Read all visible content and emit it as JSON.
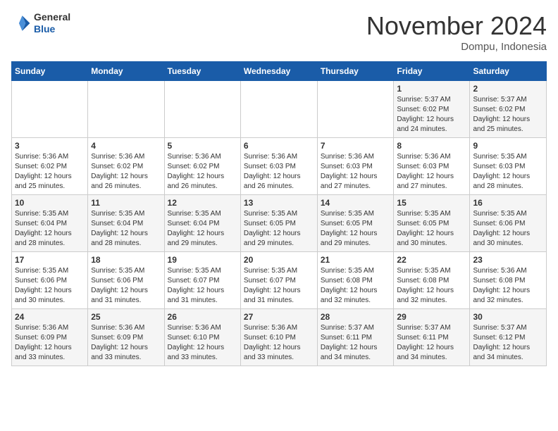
{
  "header": {
    "logo_line1": "General",
    "logo_line2": "Blue",
    "month_title": "November 2024",
    "location": "Dompu, Indonesia"
  },
  "weekdays": [
    "Sunday",
    "Monday",
    "Tuesday",
    "Wednesday",
    "Thursday",
    "Friday",
    "Saturday"
  ],
  "weeks": [
    [
      {
        "day": "",
        "info": ""
      },
      {
        "day": "",
        "info": ""
      },
      {
        "day": "",
        "info": ""
      },
      {
        "day": "",
        "info": ""
      },
      {
        "day": "",
        "info": ""
      },
      {
        "day": "1",
        "info": "Sunrise: 5:37 AM\nSunset: 6:02 PM\nDaylight: 12 hours and 24 minutes."
      },
      {
        "day": "2",
        "info": "Sunrise: 5:37 AM\nSunset: 6:02 PM\nDaylight: 12 hours and 25 minutes."
      }
    ],
    [
      {
        "day": "3",
        "info": "Sunrise: 5:36 AM\nSunset: 6:02 PM\nDaylight: 12 hours and 25 minutes."
      },
      {
        "day": "4",
        "info": "Sunrise: 5:36 AM\nSunset: 6:02 PM\nDaylight: 12 hours and 26 minutes."
      },
      {
        "day": "5",
        "info": "Sunrise: 5:36 AM\nSunset: 6:02 PM\nDaylight: 12 hours and 26 minutes."
      },
      {
        "day": "6",
        "info": "Sunrise: 5:36 AM\nSunset: 6:03 PM\nDaylight: 12 hours and 26 minutes."
      },
      {
        "day": "7",
        "info": "Sunrise: 5:36 AM\nSunset: 6:03 PM\nDaylight: 12 hours and 27 minutes."
      },
      {
        "day": "8",
        "info": "Sunrise: 5:36 AM\nSunset: 6:03 PM\nDaylight: 12 hours and 27 minutes."
      },
      {
        "day": "9",
        "info": "Sunrise: 5:35 AM\nSunset: 6:03 PM\nDaylight: 12 hours and 28 minutes."
      }
    ],
    [
      {
        "day": "10",
        "info": "Sunrise: 5:35 AM\nSunset: 6:04 PM\nDaylight: 12 hours and 28 minutes."
      },
      {
        "day": "11",
        "info": "Sunrise: 5:35 AM\nSunset: 6:04 PM\nDaylight: 12 hours and 28 minutes."
      },
      {
        "day": "12",
        "info": "Sunrise: 5:35 AM\nSunset: 6:04 PM\nDaylight: 12 hours and 29 minutes."
      },
      {
        "day": "13",
        "info": "Sunrise: 5:35 AM\nSunset: 6:05 PM\nDaylight: 12 hours and 29 minutes."
      },
      {
        "day": "14",
        "info": "Sunrise: 5:35 AM\nSunset: 6:05 PM\nDaylight: 12 hours and 29 minutes."
      },
      {
        "day": "15",
        "info": "Sunrise: 5:35 AM\nSunset: 6:05 PM\nDaylight: 12 hours and 30 minutes."
      },
      {
        "day": "16",
        "info": "Sunrise: 5:35 AM\nSunset: 6:06 PM\nDaylight: 12 hours and 30 minutes."
      }
    ],
    [
      {
        "day": "17",
        "info": "Sunrise: 5:35 AM\nSunset: 6:06 PM\nDaylight: 12 hours and 30 minutes."
      },
      {
        "day": "18",
        "info": "Sunrise: 5:35 AM\nSunset: 6:06 PM\nDaylight: 12 hours and 31 minutes."
      },
      {
        "day": "19",
        "info": "Sunrise: 5:35 AM\nSunset: 6:07 PM\nDaylight: 12 hours and 31 minutes."
      },
      {
        "day": "20",
        "info": "Sunrise: 5:35 AM\nSunset: 6:07 PM\nDaylight: 12 hours and 31 minutes."
      },
      {
        "day": "21",
        "info": "Sunrise: 5:35 AM\nSunset: 6:08 PM\nDaylight: 12 hours and 32 minutes."
      },
      {
        "day": "22",
        "info": "Sunrise: 5:35 AM\nSunset: 6:08 PM\nDaylight: 12 hours and 32 minutes."
      },
      {
        "day": "23",
        "info": "Sunrise: 5:36 AM\nSunset: 6:08 PM\nDaylight: 12 hours and 32 minutes."
      }
    ],
    [
      {
        "day": "24",
        "info": "Sunrise: 5:36 AM\nSunset: 6:09 PM\nDaylight: 12 hours and 33 minutes."
      },
      {
        "day": "25",
        "info": "Sunrise: 5:36 AM\nSunset: 6:09 PM\nDaylight: 12 hours and 33 minutes."
      },
      {
        "day": "26",
        "info": "Sunrise: 5:36 AM\nSunset: 6:10 PM\nDaylight: 12 hours and 33 minutes."
      },
      {
        "day": "27",
        "info": "Sunrise: 5:36 AM\nSunset: 6:10 PM\nDaylight: 12 hours and 33 minutes."
      },
      {
        "day": "28",
        "info": "Sunrise: 5:37 AM\nSunset: 6:11 PM\nDaylight: 12 hours and 34 minutes."
      },
      {
        "day": "29",
        "info": "Sunrise: 5:37 AM\nSunset: 6:11 PM\nDaylight: 12 hours and 34 minutes."
      },
      {
        "day": "30",
        "info": "Sunrise: 5:37 AM\nSunset: 6:12 PM\nDaylight: 12 hours and 34 minutes."
      }
    ]
  ]
}
